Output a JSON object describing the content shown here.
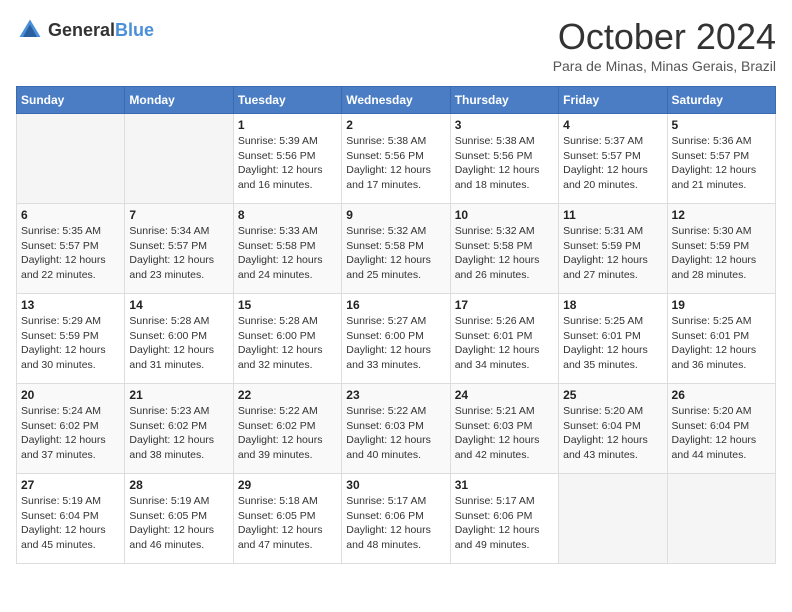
{
  "header": {
    "logo": {
      "general": "General",
      "blue": "Blue"
    },
    "title": "October 2024",
    "location": "Para de Minas, Minas Gerais, Brazil"
  },
  "days_of_week": [
    "Sunday",
    "Monday",
    "Tuesday",
    "Wednesday",
    "Thursday",
    "Friday",
    "Saturday"
  ],
  "weeks": [
    {
      "days": [
        {
          "num": "",
          "info": ""
        },
        {
          "num": "",
          "info": ""
        },
        {
          "num": "1",
          "info": "Sunrise: 5:39 AM\nSunset: 5:56 PM\nDaylight: 12 hours and 16 minutes."
        },
        {
          "num": "2",
          "info": "Sunrise: 5:38 AM\nSunset: 5:56 PM\nDaylight: 12 hours and 17 minutes."
        },
        {
          "num": "3",
          "info": "Sunrise: 5:38 AM\nSunset: 5:56 PM\nDaylight: 12 hours and 18 minutes."
        },
        {
          "num": "4",
          "info": "Sunrise: 5:37 AM\nSunset: 5:57 PM\nDaylight: 12 hours and 20 minutes."
        },
        {
          "num": "5",
          "info": "Sunrise: 5:36 AM\nSunset: 5:57 PM\nDaylight: 12 hours and 21 minutes."
        }
      ]
    },
    {
      "days": [
        {
          "num": "6",
          "info": "Sunrise: 5:35 AM\nSunset: 5:57 PM\nDaylight: 12 hours and 22 minutes."
        },
        {
          "num": "7",
          "info": "Sunrise: 5:34 AM\nSunset: 5:57 PM\nDaylight: 12 hours and 23 minutes."
        },
        {
          "num": "8",
          "info": "Sunrise: 5:33 AM\nSunset: 5:58 PM\nDaylight: 12 hours and 24 minutes."
        },
        {
          "num": "9",
          "info": "Sunrise: 5:32 AM\nSunset: 5:58 PM\nDaylight: 12 hours and 25 minutes."
        },
        {
          "num": "10",
          "info": "Sunrise: 5:32 AM\nSunset: 5:58 PM\nDaylight: 12 hours and 26 minutes."
        },
        {
          "num": "11",
          "info": "Sunrise: 5:31 AM\nSunset: 5:59 PM\nDaylight: 12 hours and 27 minutes."
        },
        {
          "num": "12",
          "info": "Sunrise: 5:30 AM\nSunset: 5:59 PM\nDaylight: 12 hours and 28 minutes."
        }
      ]
    },
    {
      "days": [
        {
          "num": "13",
          "info": "Sunrise: 5:29 AM\nSunset: 5:59 PM\nDaylight: 12 hours and 30 minutes."
        },
        {
          "num": "14",
          "info": "Sunrise: 5:28 AM\nSunset: 6:00 PM\nDaylight: 12 hours and 31 minutes."
        },
        {
          "num": "15",
          "info": "Sunrise: 5:28 AM\nSunset: 6:00 PM\nDaylight: 12 hours and 32 minutes."
        },
        {
          "num": "16",
          "info": "Sunrise: 5:27 AM\nSunset: 6:00 PM\nDaylight: 12 hours and 33 minutes."
        },
        {
          "num": "17",
          "info": "Sunrise: 5:26 AM\nSunset: 6:01 PM\nDaylight: 12 hours and 34 minutes."
        },
        {
          "num": "18",
          "info": "Sunrise: 5:25 AM\nSunset: 6:01 PM\nDaylight: 12 hours and 35 minutes."
        },
        {
          "num": "19",
          "info": "Sunrise: 5:25 AM\nSunset: 6:01 PM\nDaylight: 12 hours and 36 minutes."
        }
      ]
    },
    {
      "days": [
        {
          "num": "20",
          "info": "Sunrise: 5:24 AM\nSunset: 6:02 PM\nDaylight: 12 hours and 37 minutes."
        },
        {
          "num": "21",
          "info": "Sunrise: 5:23 AM\nSunset: 6:02 PM\nDaylight: 12 hours and 38 minutes."
        },
        {
          "num": "22",
          "info": "Sunrise: 5:22 AM\nSunset: 6:02 PM\nDaylight: 12 hours and 39 minutes."
        },
        {
          "num": "23",
          "info": "Sunrise: 5:22 AM\nSunset: 6:03 PM\nDaylight: 12 hours and 40 minutes."
        },
        {
          "num": "24",
          "info": "Sunrise: 5:21 AM\nSunset: 6:03 PM\nDaylight: 12 hours and 42 minutes."
        },
        {
          "num": "25",
          "info": "Sunrise: 5:20 AM\nSunset: 6:04 PM\nDaylight: 12 hours and 43 minutes."
        },
        {
          "num": "26",
          "info": "Sunrise: 5:20 AM\nSunset: 6:04 PM\nDaylight: 12 hours and 44 minutes."
        }
      ]
    },
    {
      "days": [
        {
          "num": "27",
          "info": "Sunrise: 5:19 AM\nSunset: 6:04 PM\nDaylight: 12 hours and 45 minutes."
        },
        {
          "num": "28",
          "info": "Sunrise: 5:19 AM\nSunset: 6:05 PM\nDaylight: 12 hours and 46 minutes."
        },
        {
          "num": "29",
          "info": "Sunrise: 5:18 AM\nSunset: 6:05 PM\nDaylight: 12 hours and 47 minutes."
        },
        {
          "num": "30",
          "info": "Sunrise: 5:17 AM\nSunset: 6:06 PM\nDaylight: 12 hours and 48 minutes."
        },
        {
          "num": "31",
          "info": "Sunrise: 5:17 AM\nSunset: 6:06 PM\nDaylight: 12 hours and 49 minutes."
        },
        {
          "num": "",
          "info": ""
        },
        {
          "num": "",
          "info": ""
        }
      ]
    }
  ]
}
